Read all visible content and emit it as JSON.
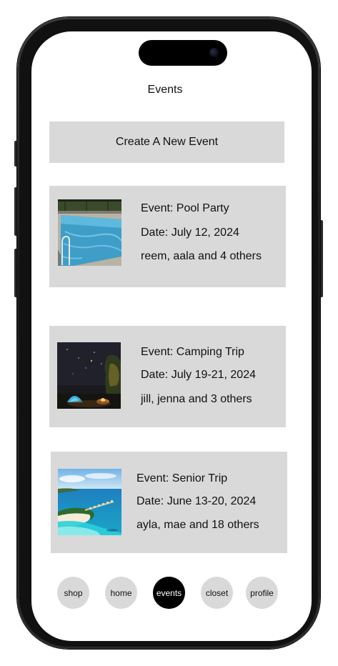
{
  "header": {
    "title": "Events"
  },
  "create_button": {
    "label": "Create A New Event"
  },
  "events": [
    {
      "name": "Event: Pool Party",
      "date": "Date: July 12, 2024",
      "attendees": "reem, aala and 4 others",
      "image_icon": "pool-photo"
    },
    {
      "name": "Event: Camping Trip",
      "date": "Date: July 19-21, 2024",
      "attendees": "jill, jenna and 3 others",
      "image_icon": "campsite-night-photo"
    },
    {
      "name": "Event: Senior Trip",
      "date": "Date: June 13-20, 2024",
      "attendees": "ayla, mae and 18 others",
      "image_icon": "tropical-beach-photo"
    }
  ],
  "nav": {
    "items": [
      {
        "label": "shop"
      },
      {
        "label": "home"
      },
      {
        "label": "events"
      },
      {
        "label": "closet"
      },
      {
        "label": "profile"
      }
    ],
    "active": "events"
  },
  "colors": {
    "card_bg": "#d9d9d9",
    "active_nav_bg": "#000000",
    "active_nav_text": "#ffffff"
  }
}
